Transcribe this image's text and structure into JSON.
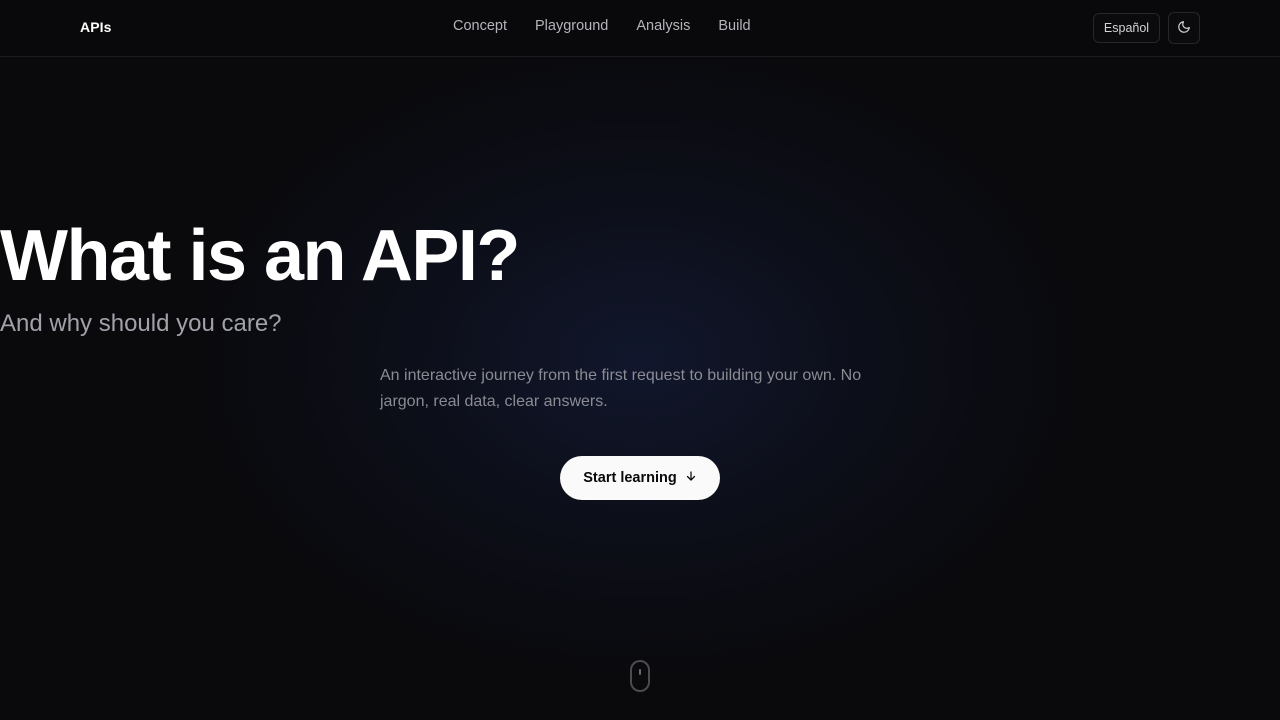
{
  "header": {
    "brand": "APIs",
    "nav": [
      "Concept",
      "Playground",
      "Analysis",
      "Build"
    ],
    "language_label": "Español",
    "theme_icon": "moon-icon"
  },
  "hero": {
    "title": "What is an API?",
    "subtitle": "And why should you care?",
    "description": "An interactive journey from the first request to building your own. No jargon, real data, clear answers.",
    "cta_label": "Start learning",
    "cta_icon": "arrow-down-icon",
    "scroll_icon": "mouse-scroll-icon"
  },
  "colors": {
    "background": "#0a0a0d",
    "text": "#ffffff",
    "muted": "#a1a1aa",
    "cta_bg": "#fafafa"
  }
}
